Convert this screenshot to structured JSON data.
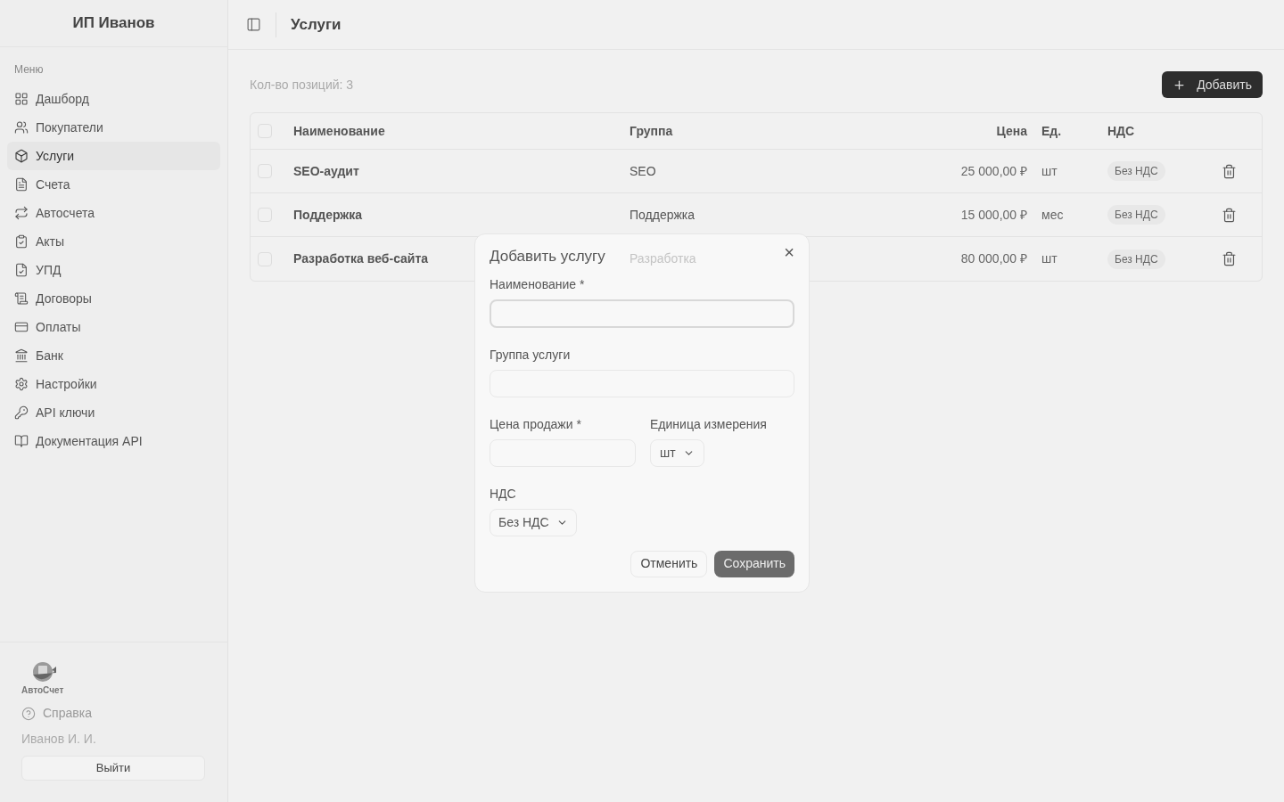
{
  "sidebar": {
    "title": "ИП Иванов",
    "section_label": "Меню",
    "items": [
      {
        "label": "Дашборд",
        "selected": false
      },
      {
        "label": "Покупатели",
        "selected": false
      },
      {
        "label": "Услуги",
        "selected": true
      },
      {
        "label": "Счета",
        "selected": false
      },
      {
        "label": "Автосчета",
        "selected": false
      },
      {
        "label": "Акты",
        "selected": false
      },
      {
        "label": "УПД",
        "selected": false
      },
      {
        "label": "Договоры",
        "selected": false
      },
      {
        "label": "Оплаты",
        "selected": false
      },
      {
        "label": "Банк",
        "selected": false
      },
      {
        "label": "Настройки",
        "selected": false
      },
      {
        "label": "API ключи",
        "selected": false
      },
      {
        "label": "Документация API",
        "selected": false
      }
    ],
    "logo_text": "АвтоСчет",
    "help": "Справка",
    "user": "Иванов И. И.",
    "logout": "Выйти"
  },
  "header": {
    "title": "Услуги"
  },
  "count": "Кол-во позиций: 3",
  "add_button": "Добавить",
  "table": {
    "all_checked": false,
    "columns": [
      "Наименование",
      "Группа",
      "Цена",
      "Ед.",
      "НДС"
    ],
    "rows": [
      {
        "name": "SEO-аудит",
        "group": "SEO",
        "price": "25 000,00 ₽",
        "unit": "шт",
        "vat": "Без НДС",
        "checked": false
      },
      {
        "name": "Поддержка",
        "group": "Поддержка",
        "price": "15 000,00 ₽",
        "unit": "мес",
        "vat": "Без НДС",
        "checked": false
      },
      {
        "name": "Разработка веб-сайта",
        "group": "Разработка",
        "price": "80 000,00 ₽",
        "unit": "шт",
        "vat": "Без НДС",
        "checked": false
      }
    ]
  },
  "dialog": {
    "title": "Добавить услугу",
    "close": "×",
    "name_label": "Наименование *",
    "group_label": "Группа услуги",
    "price_label": "Цена продажи *",
    "unit_label": "Единица измерения",
    "unit_value": "шт",
    "vat_label": "НДС",
    "vat_value": "Без НДС",
    "cancel": "Отменить",
    "save": "Сохранить"
  }
}
